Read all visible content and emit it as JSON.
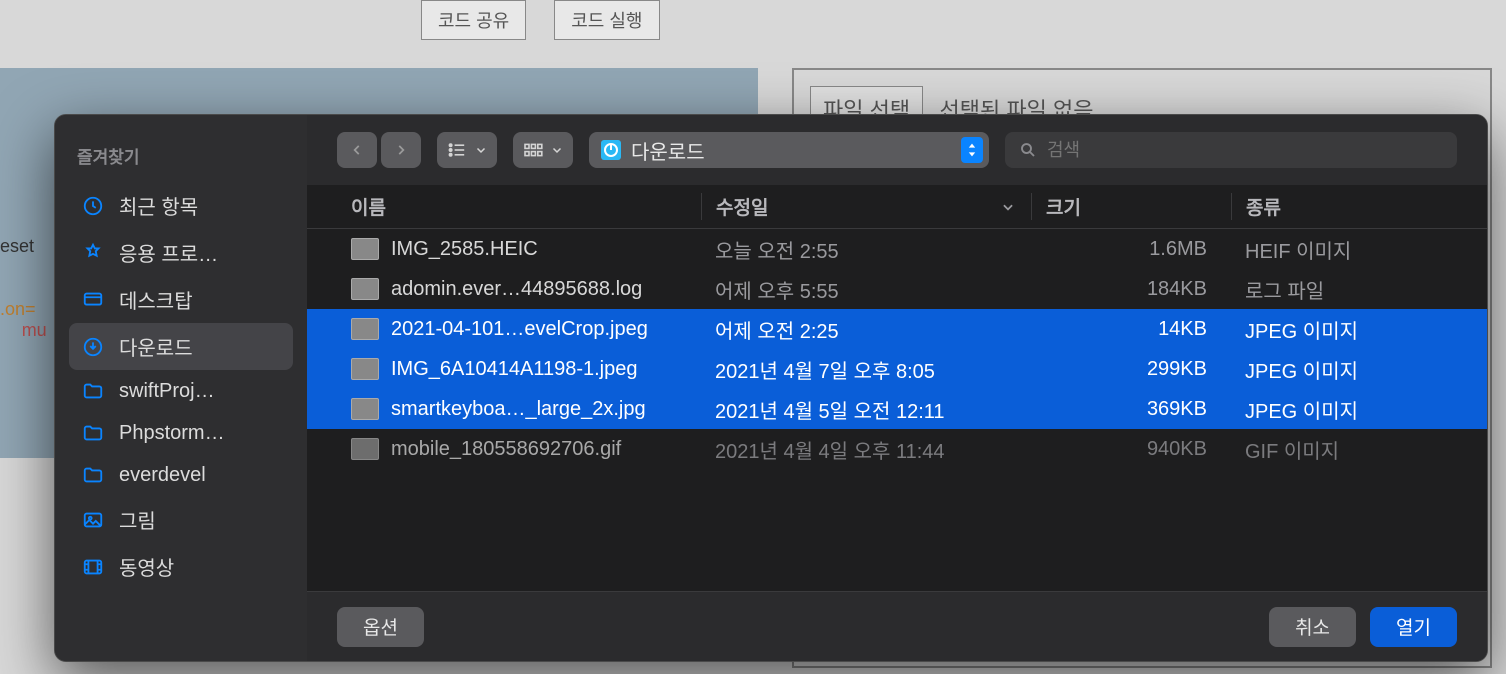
{
  "background": {
    "btn_share": "코드 공유",
    "btn_run": "코드 실행",
    "file_select": "파일 선택",
    "file_none": "선택된 파일 없음",
    "code_frag1": "eset",
    "code_frag2": ".on=",
    "code_frag3": "mu"
  },
  "sidebar": {
    "title": "즐겨찾기",
    "items": [
      {
        "label": "최근 항목"
      },
      {
        "label": "응용 프로…"
      },
      {
        "label": "데스크탑"
      },
      {
        "label": "다운로드"
      },
      {
        "label": "swiftProj…"
      },
      {
        "label": "Phpstorm…"
      },
      {
        "label": "everdevel"
      },
      {
        "label": "그림"
      },
      {
        "label": "동영상"
      }
    ]
  },
  "toolbar": {
    "location": "다운로드",
    "search_placeholder": "검색"
  },
  "columns": {
    "name": "이름",
    "date": "수정일",
    "size": "크기",
    "kind": "종류"
  },
  "files": [
    {
      "name": "IMG_2585.HEIC",
      "date": "오늘 오전 2:55",
      "size": "1.6MB",
      "kind": "HEIF 이미지",
      "selected": false
    },
    {
      "name": "adomin.ever…44895688.log",
      "date": "어제 오후 5:55",
      "size": "184KB",
      "kind": "로그 파일",
      "selected": false
    },
    {
      "name": "2021-04-101…evelCrop.jpeg",
      "date": "어제 오전 2:25",
      "size": "14KB",
      "kind": "JPEG 이미지",
      "selected": true
    },
    {
      "name": "IMG_6A10414A1198-1.jpeg",
      "date": "2021년 4월 7일 오후 8:05",
      "size": "299KB",
      "kind": "JPEG 이미지",
      "selected": true
    },
    {
      "name": "smartkeyboa…_large_2x.jpg",
      "date": "2021년 4월 5일 오전 12:11",
      "size": "369KB",
      "kind": "JPEG 이미지",
      "selected": true
    },
    {
      "name": "mobile_180558692706.gif",
      "date": "2021년 4월 4일 오후 11:44",
      "size": "940KB",
      "kind": "GIF 이미지",
      "selected": false
    }
  ],
  "footer": {
    "options": "옵션",
    "cancel": "취소",
    "open": "열기"
  }
}
